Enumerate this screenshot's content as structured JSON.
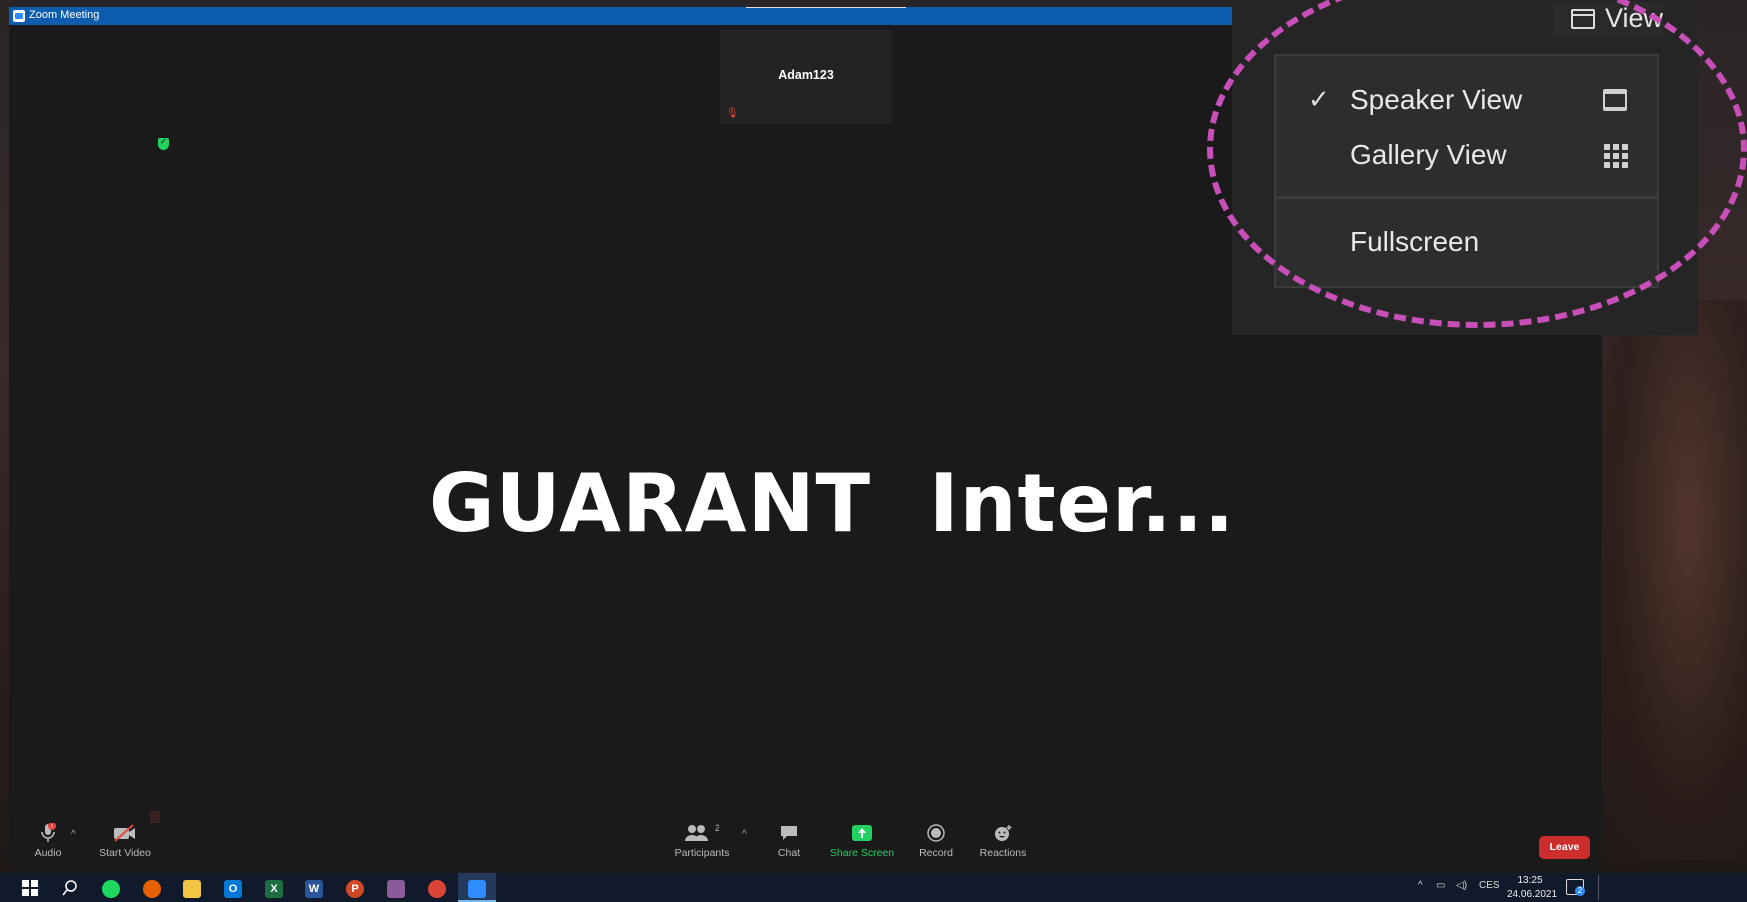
{
  "window": {
    "title": "Zoom Meeting"
  },
  "participant_tile": {
    "name": "Adam123"
  },
  "share": {
    "title": "GUARANT  Inter..."
  },
  "toolbar": {
    "audio": "Audio",
    "start_video": "Start Video",
    "participants": "Participants",
    "participants_count": "2",
    "chat": "Chat",
    "share_screen": "Share Screen",
    "record": "Record",
    "reactions": "Reactions",
    "leave": "Leave"
  },
  "view_menu": {
    "button_label": "View",
    "items": [
      "Speaker View",
      "Gallery View",
      "Fullscreen"
    ],
    "checked": "Speaker View"
  },
  "taskbar": {
    "apps": [
      "start-icon",
      "search-icon",
      "spotify-icon",
      "firefox-icon",
      "file-explorer-icon",
      "outlook-icon",
      "excel-icon",
      "word-icon",
      "powerpoint-icon",
      "paint-icon",
      "chrome-icon",
      "zoom-icon"
    ],
    "language": "CES",
    "time": "13:25",
    "date": "24.06.2021",
    "notifications": "2"
  },
  "colors": {
    "titlebar": "#0e5cad",
    "share_screen_green": "#23d160",
    "leave_red": "#cc2d2d",
    "annotation_magenta": "#c84fb8"
  }
}
